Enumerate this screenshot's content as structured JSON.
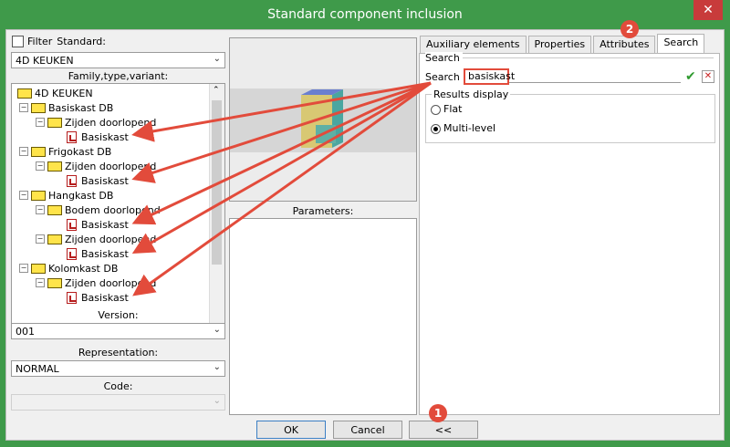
{
  "window": {
    "title": "Standard component inclusion",
    "close_glyph": "✕"
  },
  "left": {
    "filter_label": "Filter",
    "standard_label": "Standard:",
    "standard_value": "4D KEUKEN",
    "fam_label": "Family,type,variant:",
    "tree": {
      "root": "4D KEUKEN",
      "items": [
        "Basiskast DB",
        "Zijden doorlopend",
        "Basiskast",
        "Frigokast DB",
        "Zijden doorlopend",
        "Basiskast",
        "Hangkast DB",
        "Bodem doorlopend",
        "Basiskast",
        "Zijden doorlopend",
        "Basiskast",
        "Kolomkast DB",
        "Zijden doorlopend",
        "Basiskast"
      ]
    },
    "version_label": "Version:",
    "version_value": "001",
    "representation_label": "Representation:",
    "representation_value": "NORMAL",
    "code_label": "Code:"
  },
  "parameters_label": "Parameters:",
  "tabs": [
    "Auxiliary elements",
    "Properties",
    "Attributes",
    "Search"
  ],
  "search": {
    "group_label": "Search",
    "field_label": "Search",
    "field_value": "basiskast",
    "results_label": "Results display",
    "option_flat": "Flat",
    "option_multi": "Multi-level"
  },
  "buttons": {
    "ok": "OK",
    "cancel": "Cancel",
    "collapse": "<<"
  },
  "badges": {
    "one": "1",
    "two": "2"
  },
  "colors": {
    "title_bg": "#3f9a4a",
    "annotation": "#e24b3b"
  }
}
